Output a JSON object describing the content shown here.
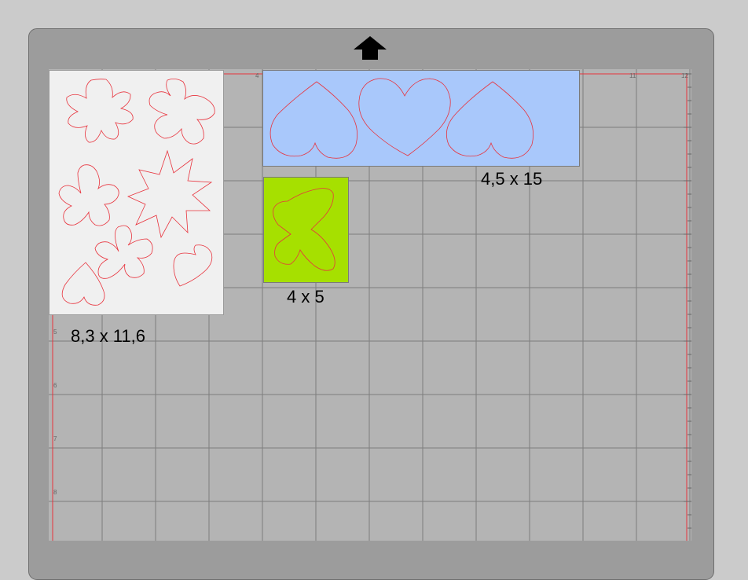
{
  "mat": {
    "ruler_top": [
      "4",
      "11",
      "12"
    ],
    "ruler_left": [
      "5",
      "6",
      "7",
      "8"
    ],
    "load_direction_icon": "arrow-up-icon"
  },
  "items": [
    {
      "name": "sheet-flowers-hearts",
      "size_label": "8,3 x 11,6",
      "color": "#f0f0f0"
    },
    {
      "name": "strip-hearts",
      "size_label": "4,5 x 15",
      "color": "#a9c8fb"
    },
    {
      "name": "butterfly-card",
      "size_label": "4 x 5",
      "color": "#a6e000"
    }
  ],
  "colors": {
    "page_bg": "#cbcbcb",
    "mat_frame": "#9c9c9c",
    "mat_surface": "#b4b4b4",
    "grid_line": "#7d7d7d",
    "cut_line": "#e8333d"
  }
}
